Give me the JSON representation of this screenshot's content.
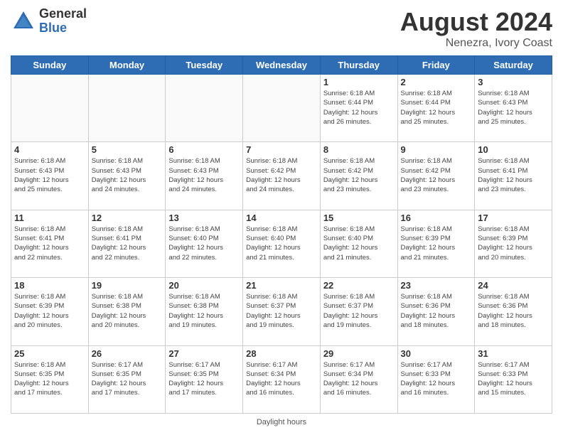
{
  "logo": {
    "general": "General",
    "blue": "Blue"
  },
  "title": {
    "month_year": "August 2024",
    "location": "Nenezra, Ivory Coast"
  },
  "days_of_week": [
    "Sunday",
    "Monday",
    "Tuesday",
    "Wednesday",
    "Thursday",
    "Friday",
    "Saturday"
  ],
  "footer": {
    "text": "Daylight hours"
  },
  "weeks": [
    [
      {
        "day": "",
        "info": ""
      },
      {
        "day": "",
        "info": ""
      },
      {
        "day": "",
        "info": ""
      },
      {
        "day": "",
        "info": ""
      },
      {
        "day": "1",
        "info": "Sunrise: 6:18 AM\nSunset: 6:44 PM\nDaylight: 12 hours\nand 26 minutes."
      },
      {
        "day": "2",
        "info": "Sunrise: 6:18 AM\nSunset: 6:44 PM\nDaylight: 12 hours\nand 25 minutes."
      },
      {
        "day": "3",
        "info": "Sunrise: 6:18 AM\nSunset: 6:43 PM\nDaylight: 12 hours\nand 25 minutes."
      }
    ],
    [
      {
        "day": "4",
        "info": "Sunrise: 6:18 AM\nSunset: 6:43 PM\nDaylight: 12 hours\nand 25 minutes."
      },
      {
        "day": "5",
        "info": "Sunrise: 6:18 AM\nSunset: 6:43 PM\nDaylight: 12 hours\nand 24 minutes."
      },
      {
        "day": "6",
        "info": "Sunrise: 6:18 AM\nSunset: 6:43 PM\nDaylight: 12 hours\nand 24 minutes."
      },
      {
        "day": "7",
        "info": "Sunrise: 6:18 AM\nSunset: 6:42 PM\nDaylight: 12 hours\nand 24 minutes."
      },
      {
        "day": "8",
        "info": "Sunrise: 6:18 AM\nSunset: 6:42 PM\nDaylight: 12 hours\nand 23 minutes."
      },
      {
        "day": "9",
        "info": "Sunrise: 6:18 AM\nSunset: 6:42 PM\nDaylight: 12 hours\nand 23 minutes."
      },
      {
        "day": "10",
        "info": "Sunrise: 6:18 AM\nSunset: 6:41 PM\nDaylight: 12 hours\nand 23 minutes."
      }
    ],
    [
      {
        "day": "11",
        "info": "Sunrise: 6:18 AM\nSunset: 6:41 PM\nDaylight: 12 hours\nand 22 minutes."
      },
      {
        "day": "12",
        "info": "Sunrise: 6:18 AM\nSunset: 6:41 PM\nDaylight: 12 hours\nand 22 minutes."
      },
      {
        "day": "13",
        "info": "Sunrise: 6:18 AM\nSunset: 6:40 PM\nDaylight: 12 hours\nand 22 minutes."
      },
      {
        "day": "14",
        "info": "Sunrise: 6:18 AM\nSunset: 6:40 PM\nDaylight: 12 hours\nand 21 minutes."
      },
      {
        "day": "15",
        "info": "Sunrise: 6:18 AM\nSunset: 6:40 PM\nDaylight: 12 hours\nand 21 minutes."
      },
      {
        "day": "16",
        "info": "Sunrise: 6:18 AM\nSunset: 6:39 PM\nDaylight: 12 hours\nand 21 minutes."
      },
      {
        "day": "17",
        "info": "Sunrise: 6:18 AM\nSunset: 6:39 PM\nDaylight: 12 hours\nand 20 minutes."
      }
    ],
    [
      {
        "day": "18",
        "info": "Sunrise: 6:18 AM\nSunset: 6:39 PM\nDaylight: 12 hours\nand 20 minutes."
      },
      {
        "day": "19",
        "info": "Sunrise: 6:18 AM\nSunset: 6:38 PM\nDaylight: 12 hours\nand 20 minutes."
      },
      {
        "day": "20",
        "info": "Sunrise: 6:18 AM\nSunset: 6:38 PM\nDaylight: 12 hours\nand 19 minutes."
      },
      {
        "day": "21",
        "info": "Sunrise: 6:18 AM\nSunset: 6:37 PM\nDaylight: 12 hours\nand 19 minutes."
      },
      {
        "day": "22",
        "info": "Sunrise: 6:18 AM\nSunset: 6:37 PM\nDaylight: 12 hours\nand 19 minutes."
      },
      {
        "day": "23",
        "info": "Sunrise: 6:18 AM\nSunset: 6:36 PM\nDaylight: 12 hours\nand 18 minutes."
      },
      {
        "day": "24",
        "info": "Sunrise: 6:18 AM\nSunset: 6:36 PM\nDaylight: 12 hours\nand 18 minutes."
      }
    ],
    [
      {
        "day": "25",
        "info": "Sunrise: 6:18 AM\nSunset: 6:35 PM\nDaylight: 12 hours\nand 17 minutes."
      },
      {
        "day": "26",
        "info": "Sunrise: 6:17 AM\nSunset: 6:35 PM\nDaylight: 12 hours\nand 17 minutes."
      },
      {
        "day": "27",
        "info": "Sunrise: 6:17 AM\nSunset: 6:35 PM\nDaylight: 12 hours\nand 17 minutes."
      },
      {
        "day": "28",
        "info": "Sunrise: 6:17 AM\nSunset: 6:34 PM\nDaylight: 12 hours\nand 16 minutes."
      },
      {
        "day": "29",
        "info": "Sunrise: 6:17 AM\nSunset: 6:34 PM\nDaylight: 12 hours\nand 16 minutes."
      },
      {
        "day": "30",
        "info": "Sunrise: 6:17 AM\nSunset: 6:33 PM\nDaylight: 12 hours\nand 16 minutes."
      },
      {
        "day": "31",
        "info": "Sunrise: 6:17 AM\nSunset: 6:33 PM\nDaylight: 12 hours\nand 15 minutes."
      }
    ]
  ]
}
